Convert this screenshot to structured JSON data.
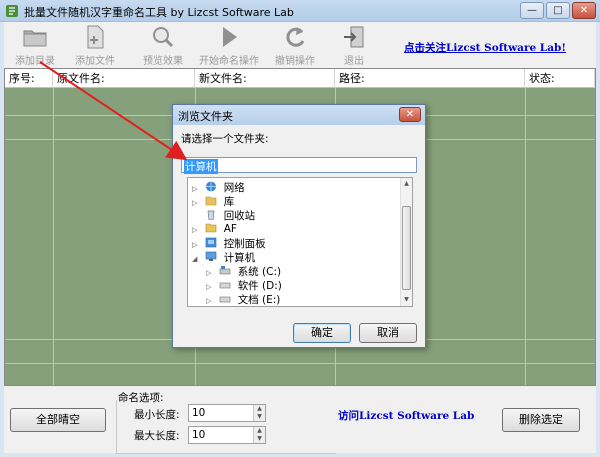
{
  "window": {
    "title": "批量文件随机汉字重命名工具  by Lizcst Software Lab",
    "min": "—",
    "max": "□",
    "close": "✕"
  },
  "toolbar": {
    "add_dir": "添加目录",
    "add_file": "添加文件",
    "preview": "预览效果",
    "start": "开始命名操作",
    "undo": "撤销操作",
    "exit": "退出",
    "follow": "点击关注Lizcst Software Lab!"
  },
  "list": {
    "columns": [
      "序号:",
      "原文件名:",
      "新文件名:",
      "路径:",
      "状态:"
    ]
  },
  "bottom": {
    "clear_all": "全部晴空",
    "options_title": "命名选项:",
    "min_len_label": "最小长度:",
    "min_len_value": "10",
    "max_len_label": "最大长度:",
    "max_len_value": "10",
    "visit": "访问Lizcst Software Lab",
    "delete_selected": "删除选定"
  },
  "dialog": {
    "title": "浏览文件夹",
    "close": "✕",
    "prompt": "请选择一个文件夹:",
    "path": "计算机",
    "ok": "确定",
    "cancel": "取消",
    "tree": {
      "network": "网络",
      "library": "库",
      "recycle": "回收站",
      "af": "AF",
      "control": "控制面板",
      "computer": "计算机",
      "drive_c": "系统 (C:)",
      "drive_d": "软件 (D:)",
      "drive_e": "文档 (E:)"
    }
  },
  "colors": {
    "list_bg": "#86a07c",
    "link": "#0000cc",
    "arrow": "#e02020"
  }
}
